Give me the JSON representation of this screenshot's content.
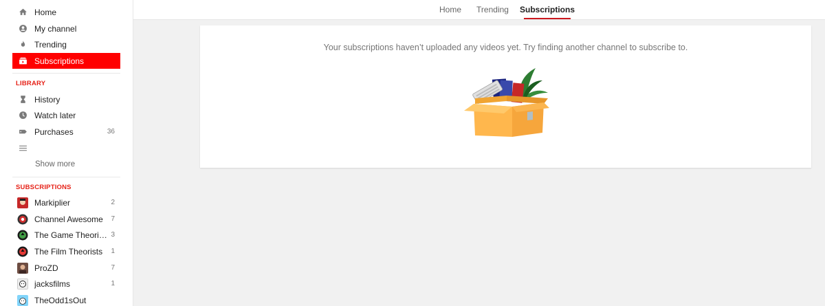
{
  "sidebar": {
    "main": [
      {
        "label": "Home",
        "icon": "home-icon"
      },
      {
        "label": "My channel",
        "icon": "account-icon"
      },
      {
        "label": "Trending",
        "icon": "flame-icon"
      },
      {
        "label": "Subscriptions",
        "icon": "subscriptions-icon",
        "active": true
      }
    ],
    "library_title": "LIBRARY",
    "library": [
      {
        "label": "History",
        "icon": "hourglass-icon"
      },
      {
        "label": "Watch later",
        "icon": "clock-icon"
      },
      {
        "label": "Purchases",
        "icon": "tag-icon",
        "count": "36"
      },
      {
        "label": "",
        "icon": "playlist-icon"
      }
    ],
    "show_more": "Show more",
    "subscriptions_title": "SUBSCRIPTIONS",
    "subscriptions": [
      {
        "label": "Markiplier",
        "count": "2"
      },
      {
        "label": "Channel Awesome",
        "count": "7"
      },
      {
        "label": "The Game Theori…",
        "count": "3"
      },
      {
        "label": "The Film Theorists",
        "count": "1"
      },
      {
        "label": "ProZD",
        "count": "7"
      },
      {
        "label": "jacksfilms",
        "count": "1"
      },
      {
        "label": "TheOdd1sOut",
        "count": ""
      }
    ]
  },
  "tabs": [
    {
      "label": "Home"
    },
    {
      "label": "Trending"
    },
    {
      "label": "Subscriptions",
      "active": true
    }
  ],
  "content": {
    "empty_message": "Your subscriptions haven’t uploaded any videos yet. Try finding another channel to subscribe to."
  },
  "colors": {
    "accent": "#ff0000",
    "tab_underline": "#cc181e",
    "section_title": "#e62117",
    "background": "#f1f1f1"
  }
}
